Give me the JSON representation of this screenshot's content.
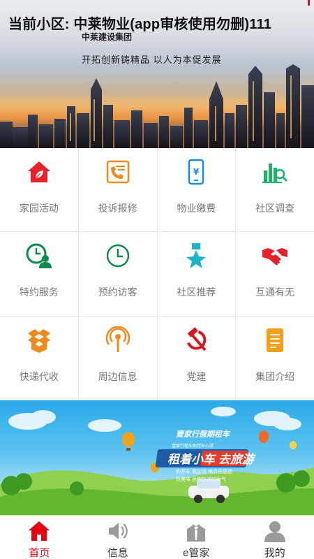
{
  "header": {
    "title": "当前小区: 中莱物业(app审核使用勿删)111",
    "company": "中莱建设集团",
    "slogan": "开拓创新铸精品  以人为本促发展"
  },
  "menu": [
    {
      "label": "家园活动",
      "icon": "house-leaf-icon",
      "color": "#e8202a"
    },
    {
      "label": "投诉报修",
      "icon": "phone-document-icon",
      "color": "#f28a1b"
    },
    {
      "label": "物业缴费",
      "icon": "mobile-yen-icon",
      "color": "#1a8de0"
    },
    {
      "label": "社区调查",
      "icon": "chart-magnifier-icon",
      "color": "#1db36a"
    },
    {
      "label": "特约服务",
      "icon": "clock-person-icon",
      "color": "#0e8a4a"
    },
    {
      "label": "预约访客",
      "icon": "clock-icon",
      "color": "#0e8a4a"
    },
    {
      "label": "社区推荐",
      "icon": "medal-star-icon",
      "color": "#18b5c8"
    },
    {
      "label": "互通有无",
      "icon": "handshake-icon",
      "color": "#e8202a"
    },
    {
      "label": "快递代收",
      "icon": "package-icon",
      "color": "#f28a1b"
    },
    {
      "label": "周边信息",
      "icon": "broadcast-icon",
      "color": "#f28a1b"
    },
    {
      "label": "党建",
      "icon": "hammer-sickle-icon",
      "color": "#d9161c"
    },
    {
      "label": "集团介绍",
      "icon": "document-list-icon",
      "color": "#f2a01b"
    }
  ],
  "ad": {
    "tag1": "壹家行假期租车",
    "tag2": "壹家行租车助您安心游",
    "headline": "租着小车 去旅游",
    "line1": "你开车  我加油  地点任您选",
    "line2": "找美味  品你生活的香气"
  },
  "nav": [
    {
      "label": "首页",
      "icon": "home-icon",
      "active": true
    },
    {
      "label": "信息",
      "icon": "speaker-icon",
      "active": false
    },
    {
      "label": "e管家",
      "icon": "butler-icon",
      "active": false
    },
    {
      "label": "我的",
      "icon": "user-icon",
      "active": false
    }
  ],
  "colors": {
    "accent": "#e60012",
    "label_gray": "#777777",
    "divider": "#e5e5e5"
  }
}
